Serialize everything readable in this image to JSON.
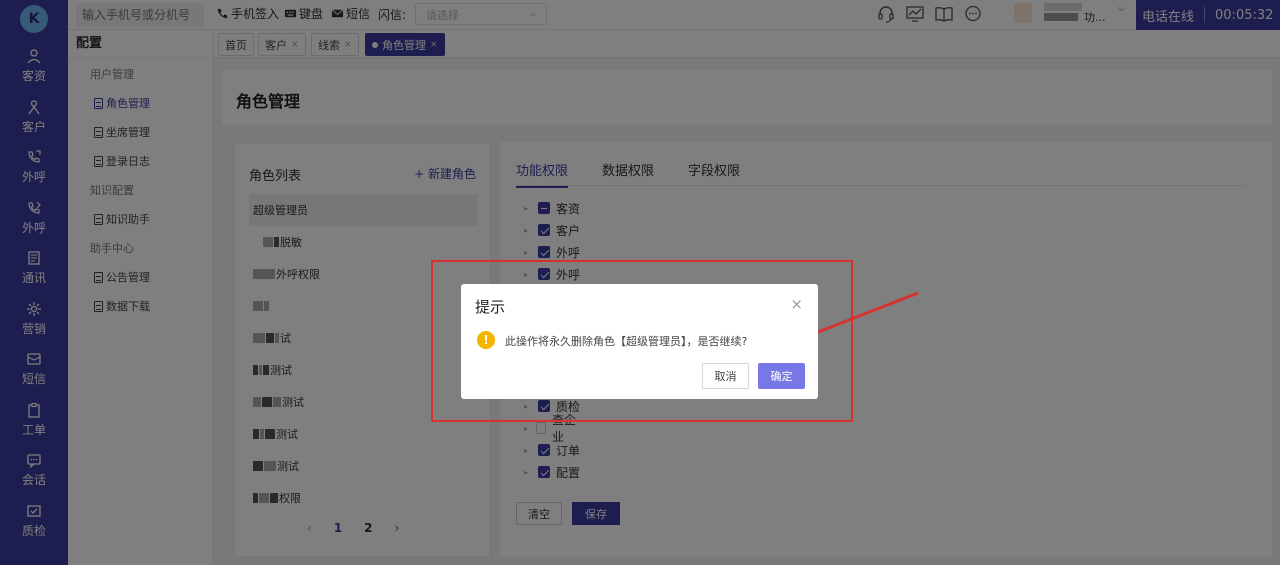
{
  "rail": {
    "logo": "K",
    "items": [
      {
        "label": "客资",
        "icon": "customer-leads-icon"
      },
      {
        "label": "客户",
        "icon": "customer-icon"
      },
      {
        "label": "外呼",
        "icon": "outbound-call-icon"
      },
      {
        "label": "外呼",
        "icon": "outbound-call-alt-icon"
      },
      {
        "label": "通讯",
        "icon": "contacts-icon"
      },
      {
        "label": "营销",
        "icon": "marketing-gear-icon"
      },
      {
        "label": "短信",
        "icon": "sms-icon"
      },
      {
        "label": "工单",
        "icon": "ticket-icon"
      },
      {
        "label": "会话",
        "icon": "chat-icon"
      },
      {
        "label": "质检",
        "icon": "quality-check-icon"
      }
    ]
  },
  "topbar": {
    "phone_placeholder": "输入手机号或分机号",
    "phone_signin": "手机签入",
    "keypad": "键盘",
    "sms": "短信",
    "flash_label": "闪信:",
    "flash_placeholder": "请选择",
    "user_suffix": "功...",
    "status": "电话在线",
    "timer": "00:05:32"
  },
  "config_menu": {
    "title": "配置",
    "groups": [
      {
        "label": "用户管理",
        "items": [
          "角色管理",
          "坐席管理",
          "登录日志"
        ]
      },
      {
        "label": "知识配置",
        "items": [
          "知识助手"
        ]
      },
      {
        "label": "助手中心",
        "items": [
          "公告管理",
          "数据下载"
        ]
      }
    ],
    "active": "角色管理"
  },
  "tabs": [
    {
      "label": "首页",
      "closable": false
    },
    {
      "label": "客户",
      "closable": true
    },
    {
      "label": "线索",
      "closable": true
    },
    {
      "label": "角色管理",
      "closable": true,
      "active": true
    }
  ],
  "page": {
    "title": "角色管理",
    "role_list_title": "角色列表",
    "new_role": "+ 新建角色",
    "roles": [
      "超级管理员",
      "脱敏",
      "外呼权限",
      "",
      "试",
      "测试",
      "测试",
      "测试",
      "测试",
      "权限"
    ],
    "pages": [
      "1",
      "2"
    ],
    "perm_tabs": [
      "功能权限",
      "数据权限",
      "字段权限"
    ],
    "perm_nodes_top": [
      {
        "label": "客资",
        "state": "half"
      },
      {
        "label": "客户",
        "state": "on"
      },
      {
        "label": "外呼",
        "state": "on"
      },
      {
        "label": "外呼",
        "state": "on"
      }
    ],
    "perm_nodes_bottom": [
      {
        "label": "质检",
        "state": "on"
      },
      {
        "label": "查企业",
        "state": "off"
      },
      {
        "label": "订单",
        "state": "on"
      },
      {
        "label": "配置",
        "state": "on"
      }
    ],
    "clear": "清空",
    "save": "保存"
  },
  "dialog": {
    "title": "提示",
    "message": "此操作将永久删除角色【超级管理员】，是否继续?",
    "cancel": "取消",
    "confirm": "确定"
  },
  "colors": {
    "primary": "#3a3d9f",
    "annotation": "#d6322f",
    "warning": "#f4b400"
  }
}
